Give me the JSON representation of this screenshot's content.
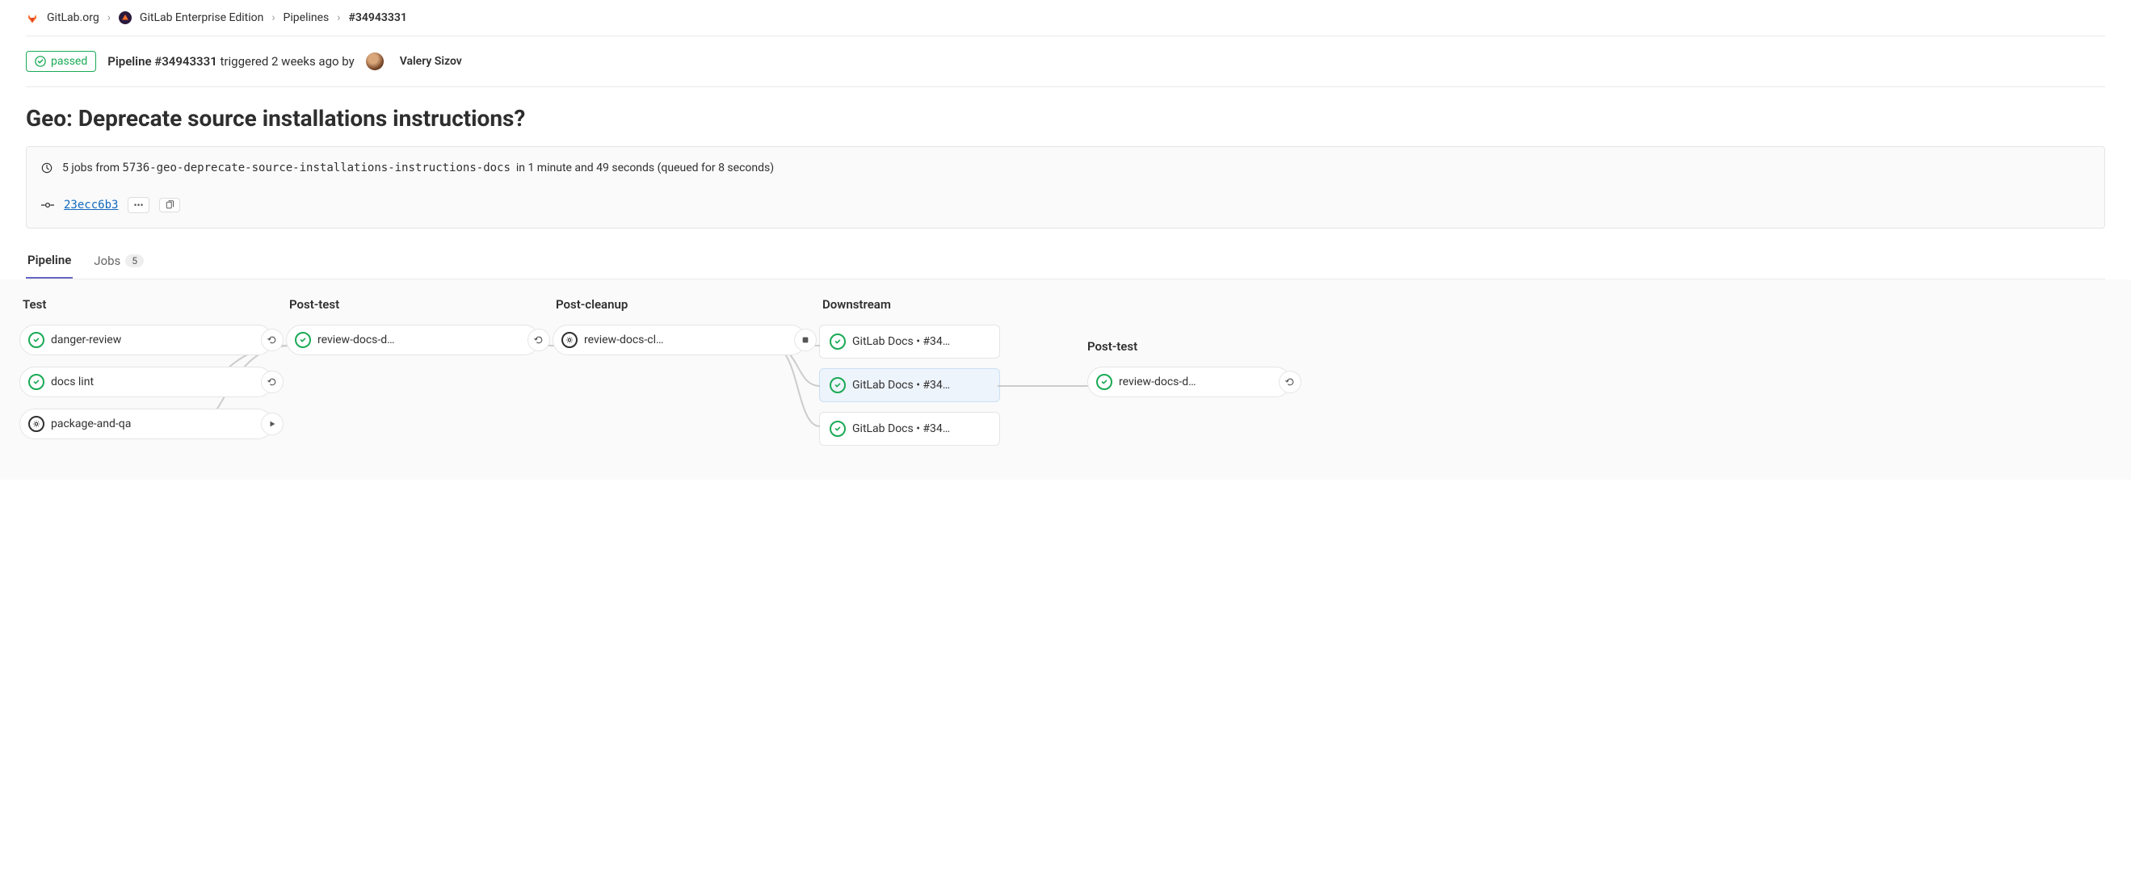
{
  "breadcrumbs": {
    "org": "GitLab.org",
    "project": "GitLab Enterprise Edition",
    "section": "Pipelines",
    "id": "#34943331"
  },
  "header": {
    "status": "passed",
    "pipeline_label": "Pipeline #34943331",
    "triggered_text": "triggered 2 weeks ago by",
    "user": "Valery Sizov"
  },
  "title": "Geo: Deprecate source installations instructions?",
  "info": {
    "jobs_prefix": "5 jobs from",
    "branch": "5736-geo-deprecate-source-installations-instructions-docs",
    "duration": "in 1 minute and 49 seconds (queued for 8 seconds)",
    "commit_sha": "23ecc6b3",
    "ellipsis": "•••"
  },
  "tabs": {
    "pipeline": "Pipeline",
    "jobs": "Jobs",
    "jobs_count": "5"
  },
  "stages": {
    "test": {
      "title": "Test",
      "jobs": [
        {
          "name": "danger-review",
          "status": "passed",
          "action": "retry"
        },
        {
          "name": "docs lint",
          "status": "passed",
          "action": "retry"
        },
        {
          "name": "package-and-qa",
          "status": "manual",
          "action": "play"
        }
      ]
    },
    "post_test": {
      "title": "Post-test",
      "jobs": [
        {
          "name": "review-docs-d…",
          "status": "passed",
          "action": "retry"
        }
      ]
    },
    "post_cleanup": {
      "title": "Post-cleanup",
      "jobs": [
        {
          "name": "review-docs-cl…",
          "status": "manual",
          "action": "stop"
        }
      ]
    },
    "downstream": {
      "title": "Downstream",
      "items": [
        {
          "label": "GitLab Docs  •  #34…",
          "status": "passed"
        },
        {
          "label": "GitLab Docs  •  #34…",
          "status": "passed",
          "selected": true
        },
        {
          "label": "GitLab Docs  •  #34…",
          "status": "passed"
        }
      ]
    },
    "ds_post_test": {
      "title": "Post-test",
      "jobs": [
        {
          "name": "review-docs-d…",
          "status": "passed",
          "action": "retry"
        }
      ]
    }
  }
}
